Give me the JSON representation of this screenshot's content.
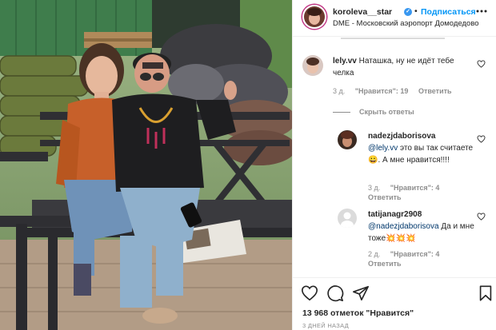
{
  "post": {
    "username": "koroleva__star",
    "verified": true,
    "separator": "•",
    "subscribe_label": "Подписаться",
    "location": "DME - Московский аэропорт Домодедово",
    "more_icon": "more-horizontal-icon"
  },
  "comments": [
    {
      "username": "lely.vv",
      "text": "Наташка, ну не идёт тебе челка",
      "age": "3 д.",
      "likes": "\"Нравится\": 19",
      "reply_label": "Ответить",
      "hide_replies_label": "Скрыть ответы",
      "replies": [
        {
          "username": "nadezjdaborisova",
          "mention": "@lely.vv",
          "text": "это вы так считаете😀. А мне нравится!!!!",
          "age": "3 д.",
          "likes": "\"Нравится\": 4",
          "reply_label": "Ответить"
        },
        {
          "username": "tatijanagr2908",
          "mention": "@nadezjdaborisova",
          "text": "Да и мне тоже💥💥💥",
          "age": "2 д.",
          "likes": "\"Нравится\": 4",
          "reply_label": "Ответить"
        }
      ]
    }
  ],
  "actions": {
    "icons": [
      "heart-icon",
      "comment-icon",
      "share-icon",
      "bookmark-icon"
    ],
    "likes_count": "13 968 отметок",
    "likes_link": "\"Нравится\"",
    "date": "3 ДНЕЙ НАЗАД"
  },
  "colors": {
    "accent": "#0095f6",
    "verified": "#3897f0",
    "muted": "#8e8e8e",
    "text": "#262626"
  }
}
